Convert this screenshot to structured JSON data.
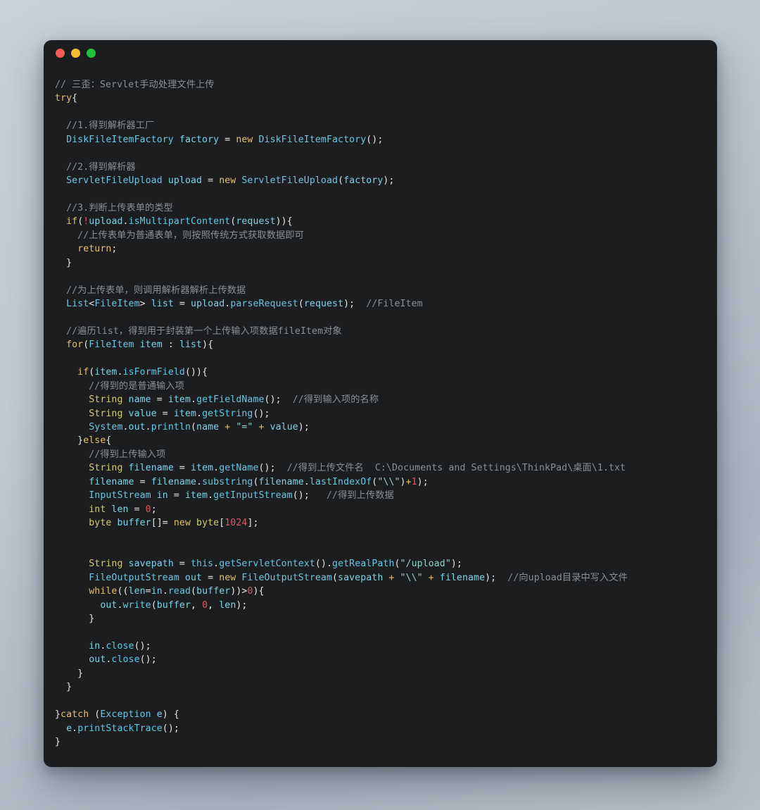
{
  "window": {
    "title": "",
    "traffic_lights": [
      {
        "name": "close",
        "color": "#f25d55"
      },
      {
        "name": "minimize",
        "color": "#f4bd2f"
      },
      {
        "name": "maximize",
        "color": "#21c23c"
      }
    ]
  },
  "editor": {
    "language": "java",
    "theme": "dark",
    "background": "#1b1d1f",
    "page_background": "#c0c8d2",
    "palette": {
      "comment": "#8b9095",
      "keyword": "#e3c06a",
      "type": "#d4cb74",
      "class": "#6fc5e0",
      "identifier": "#7fd3e8",
      "operator": "#e6e6e6",
      "number": "#e05561",
      "string": "#8fd6c4",
      "foreground": "#d7dadd"
    },
    "lines": [
      {
        "n": 1,
        "indent": 0,
        "tokens": [
          {
            "t": "// 三歪：Servlet手动处理文件上传",
            "c": "cm"
          }
        ]
      },
      {
        "n": 2,
        "indent": 0,
        "tokens": [
          {
            "t": "try",
            "c": "kw"
          },
          {
            "t": "{",
            "c": "op"
          }
        ]
      },
      {
        "n": 3,
        "indent": 0,
        "tokens": []
      },
      {
        "n": 4,
        "indent": 1,
        "tokens": [
          {
            "t": "//1.得到解析器工厂",
            "c": "cm"
          }
        ]
      },
      {
        "n": 5,
        "indent": 1,
        "tokens": [
          {
            "t": "DiskFileItemFactory",
            "c": "cls"
          },
          {
            "t": " factory ",
            "c": "id"
          },
          {
            "t": "= ",
            "c": "op"
          },
          {
            "t": "new ",
            "c": "kw"
          },
          {
            "t": "DiskFileItemFactory",
            "c": "cls"
          },
          {
            "t": "();",
            "c": "op"
          }
        ]
      },
      {
        "n": 6,
        "indent": 0,
        "tokens": []
      },
      {
        "n": 7,
        "indent": 1,
        "tokens": [
          {
            "t": "//2.得到解析器",
            "c": "cm"
          }
        ]
      },
      {
        "n": 8,
        "indent": 1,
        "tokens": [
          {
            "t": "ServletFileUpload",
            "c": "cls"
          },
          {
            "t": " upload ",
            "c": "id"
          },
          {
            "t": "= ",
            "c": "op"
          },
          {
            "t": "new ",
            "c": "kw"
          },
          {
            "t": "ServletFileUpload",
            "c": "cls"
          },
          {
            "t": "(",
            "c": "op"
          },
          {
            "t": "factory",
            "c": "id"
          },
          {
            "t": ");",
            "c": "op"
          }
        ]
      },
      {
        "n": 9,
        "indent": 0,
        "tokens": []
      },
      {
        "n": 10,
        "indent": 1,
        "tokens": [
          {
            "t": "//3.判断上传表单的类型",
            "c": "cm"
          }
        ]
      },
      {
        "n": 11,
        "indent": 1,
        "tokens": [
          {
            "t": "if",
            "c": "kw"
          },
          {
            "t": "(",
            "c": "op"
          },
          {
            "t": "!",
            "c": "num"
          },
          {
            "t": "upload",
            "c": "id"
          },
          {
            "t": ".",
            "c": "op"
          },
          {
            "t": "isMultipartContent",
            "c": "fn"
          },
          {
            "t": "(",
            "c": "op"
          },
          {
            "t": "request",
            "c": "id"
          },
          {
            "t": ")){",
            "c": "op"
          }
        ]
      },
      {
        "n": 12,
        "indent": 2,
        "tokens": [
          {
            "t": "//上传表单为普通表单，则按照传统方式获取数据即可",
            "c": "cm"
          }
        ]
      },
      {
        "n": 13,
        "indent": 2,
        "tokens": [
          {
            "t": "return",
            "c": "kw"
          },
          {
            "t": ";",
            "c": "op"
          }
        ]
      },
      {
        "n": 14,
        "indent": 1,
        "tokens": [
          {
            "t": "}",
            "c": "op"
          }
        ]
      },
      {
        "n": 15,
        "indent": 0,
        "tokens": []
      },
      {
        "n": 16,
        "indent": 1,
        "tokens": [
          {
            "t": "//为上传表单，则调用解析器解析上传数据",
            "c": "cm"
          }
        ]
      },
      {
        "n": 17,
        "indent": 1,
        "tokens": [
          {
            "t": "List",
            "c": "cls"
          },
          {
            "t": "<",
            "c": "op"
          },
          {
            "t": "FileItem",
            "c": "cls"
          },
          {
            "t": "> ",
            "c": "op"
          },
          {
            "t": "list ",
            "c": "id"
          },
          {
            "t": "= ",
            "c": "op"
          },
          {
            "t": "upload",
            "c": "id"
          },
          {
            "t": ".",
            "c": "op"
          },
          {
            "t": "parseRequest",
            "c": "fn"
          },
          {
            "t": "(",
            "c": "op"
          },
          {
            "t": "request",
            "c": "id"
          },
          {
            "t": ");  ",
            "c": "op"
          },
          {
            "t": "//FileItem",
            "c": "cm"
          }
        ]
      },
      {
        "n": 18,
        "indent": 0,
        "tokens": []
      },
      {
        "n": 19,
        "indent": 1,
        "tokens": [
          {
            "t": "//遍历list，得到用于封装第一个上传输入项数据fileItem对象",
            "c": "cm"
          }
        ]
      },
      {
        "n": 20,
        "indent": 1,
        "tokens": [
          {
            "t": "for",
            "c": "kw"
          },
          {
            "t": "(",
            "c": "op"
          },
          {
            "t": "FileItem",
            "c": "cls"
          },
          {
            "t": " item ",
            "c": "id"
          },
          {
            "t": ": ",
            "c": "op"
          },
          {
            "t": "list",
            "c": "id"
          },
          {
            "t": "){",
            "c": "op"
          }
        ]
      },
      {
        "n": 21,
        "indent": 0,
        "tokens": []
      },
      {
        "n": 22,
        "indent": 2,
        "tokens": [
          {
            "t": "if",
            "c": "kw"
          },
          {
            "t": "(",
            "c": "op"
          },
          {
            "t": "item",
            "c": "id"
          },
          {
            "t": ".",
            "c": "op"
          },
          {
            "t": "isFormField",
            "c": "fn"
          },
          {
            "t": "()){",
            "c": "op"
          }
        ]
      },
      {
        "n": 23,
        "indent": 3,
        "tokens": [
          {
            "t": "//得到的是普通输入项",
            "c": "cm"
          }
        ]
      },
      {
        "n": 24,
        "indent": 3,
        "tokens": [
          {
            "t": "String",
            "c": "ty"
          },
          {
            "t": " name ",
            "c": "id"
          },
          {
            "t": "= ",
            "c": "op"
          },
          {
            "t": "item",
            "c": "id"
          },
          {
            "t": ".",
            "c": "op"
          },
          {
            "t": "getFieldName",
            "c": "fn"
          },
          {
            "t": "();  ",
            "c": "op"
          },
          {
            "t": "//得到输入项的名称",
            "c": "cm"
          }
        ]
      },
      {
        "n": 25,
        "indent": 3,
        "tokens": [
          {
            "t": "String",
            "c": "ty"
          },
          {
            "t": " value ",
            "c": "id"
          },
          {
            "t": "= ",
            "c": "op"
          },
          {
            "t": "item",
            "c": "id"
          },
          {
            "t": ".",
            "c": "op"
          },
          {
            "t": "getString",
            "c": "fn"
          },
          {
            "t": "();",
            "c": "op"
          }
        ]
      },
      {
        "n": 26,
        "indent": 3,
        "tokens": [
          {
            "t": "System",
            "c": "cls"
          },
          {
            "t": ".",
            "c": "op"
          },
          {
            "t": "out",
            "c": "id"
          },
          {
            "t": ".",
            "c": "op"
          },
          {
            "t": "println",
            "c": "fn"
          },
          {
            "t": "(",
            "c": "op"
          },
          {
            "t": "name ",
            "c": "id"
          },
          {
            "t": "+ ",
            "c": "opy"
          },
          {
            "t": "\"=\"",
            "c": "str"
          },
          {
            "t": " + ",
            "c": "opy"
          },
          {
            "t": "value",
            "c": "id"
          },
          {
            "t": ");",
            "c": "op"
          }
        ]
      },
      {
        "n": 27,
        "indent": 2,
        "tokens": [
          {
            "t": "}",
            "c": "op"
          },
          {
            "t": "else",
            "c": "kw"
          },
          {
            "t": "{",
            "c": "op"
          }
        ]
      },
      {
        "n": 28,
        "indent": 3,
        "tokens": [
          {
            "t": "//得到上传输入项",
            "c": "cm"
          }
        ]
      },
      {
        "n": 29,
        "indent": 3,
        "tokens": [
          {
            "t": "String",
            "c": "ty"
          },
          {
            "t": " filename ",
            "c": "id"
          },
          {
            "t": "= ",
            "c": "op"
          },
          {
            "t": "item",
            "c": "id"
          },
          {
            "t": ".",
            "c": "op"
          },
          {
            "t": "getName",
            "c": "fn"
          },
          {
            "t": "();  ",
            "c": "op"
          },
          {
            "t": "//得到上传文件名  C:\\Documents and Settings\\ThinkPad\\桌面\\1.txt",
            "c": "cm"
          }
        ]
      },
      {
        "n": 30,
        "indent": 3,
        "tokens": [
          {
            "t": "filename ",
            "c": "id"
          },
          {
            "t": "= ",
            "c": "op"
          },
          {
            "t": "filename",
            "c": "id"
          },
          {
            "t": ".",
            "c": "op"
          },
          {
            "t": "substring",
            "c": "fn"
          },
          {
            "t": "(",
            "c": "op"
          },
          {
            "t": "filename",
            "c": "id"
          },
          {
            "t": ".",
            "c": "op"
          },
          {
            "t": "lastIndexOf",
            "c": "fn"
          },
          {
            "t": "(",
            "c": "op"
          },
          {
            "t": "\"\\\\\"",
            "c": "str"
          },
          {
            "t": ")",
            "c": "op"
          },
          {
            "t": "+",
            "c": "opy"
          },
          {
            "t": "1",
            "c": "num"
          },
          {
            "t": ");",
            "c": "op"
          }
        ]
      },
      {
        "n": 31,
        "indent": 3,
        "tokens": [
          {
            "t": "InputStream",
            "c": "cls"
          },
          {
            "t": " in ",
            "c": "id"
          },
          {
            "t": "= ",
            "c": "op"
          },
          {
            "t": "item",
            "c": "id"
          },
          {
            "t": ".",
            "c": "op"
          },
          {
            "t": "getInputStream",
            "c": "fn"
          },
          {
            "t": "();   ",
            "c": "op"
          },
          {
            "t": "//得到上传数据",
            "c": "cm"
          }
        ]
      },
      {
        "n": 32,
        "indent": 3,
        "tokens": [
          {
            "t": "int",
            "c": "ty"
          },
          {
            "t": " len ",
            "c": "id"
          },
          {
            "t": "= ",
            "c": "op"
          },
          {
            "t": "0",
            "c": "num"
          },
          {
            "t": ";",
            "c": "op"
          }
        ]
      },
      {
        "n": 33,
        "indent": 3,
        "tokens": [
          {
            "t": "byte",
            "c": "ty"
          },
          {
            "t": " buffer",
            "c": "id"
          },
          {
            "t": "[]= ",
            "c": "op"
          },
          {
            "t": "new ",
            "c": "kw"
          },
          {
            "t": "byte",
            "c": "ty"
          },
          {
            "t": "[",
            "c": "op"
          },
          {
            "t": "1024",
            "c": "num"
          },
          {
            "t": "];",
            "c": "op"
          }
        ]
      },
      {
        "n": 34,
        "indent": 0,
        "tokens": []
      },
      {
        "n": 35,
        "indent": 0,
        "tokens": []
      },
      {
        "n": 36,
        "indent": 3,
        "tokens": [
          {
            "t": "String",
            "c": "ty"
          },
          {
            "t": " savepath ",
            "c": "id"
          },
          {
            "t": "= ",
            "c": "op"
          },
          {
            "t": "this",
            "c": "cls"
          },
          {
            "t": ".",
            "c": "op"
          },
          {
            "t": "getServletContext",
            "c": "fn"
          },
          {
            "t": "()",
            "c": "op"
          },
          {
            "t": ".",
            "c": "op"
          },
          {
            "t": "getRealPath",
            "c": "fn"
          },
          {
            "t": "(",
            "c": "op"
          },
          {
            "t": "\"/upload\"",
            "c": "str"
          },
          {
            "t": ");",
            "c": "op"
          }
        ]
      },
      {
        "n": 37,
        "indent": 3,
        "tokens": [
          {
            "t": "FileOutputStream",
            "c": "cls"
          },
          {
            "t": " out ",
            "c": "id"
          },
          {
            "t": "= ",
            "c": "op"
          },
          {
            "t": "new ",
            "c": "kw"
          },
          {
            "t": "FileOutputStream",
            "c": "cls"
          },
          {
            "t": "(",
            "c": "op"
          },
          {
            "t": "savepath ",
            "c": "id"
          },
          {
            "t": "+ ",
            "c": "opy"
          },
          {
            "t": "\"\\\\\"",
            "c": "str"
          },
          {
            "t": " + ",
            "c": "opy"
          },
          {
            "t": "filename",
            "c": "id"
          },
          {
            "t": ");  ",
            "c": "op"
          },
          {
            "t": "//向upload目录中写入文件",
            "c": "cm"
          }
        ]
      },
      {
        "n": 38,
        "indent": 3,
        "tokens": [
          {
            "t": "while",
            "c": "kw"
          },
          {
            "t": "((",
            "c": "op"
          },
          {
            "t": "len",
            "c": "id"
          },
          {
            "t": "=",
            "c": "op"
          },
          {
            "t": "in",
            "c": "id"
          },
          {
            "t": ".",
            "c": "op"
          },
          {
            "t": "read",
            "c": "fn"
          },
          {
            "t": "(",
            "c": "op"
          },
          {
            "t": "buffer",
            "c": "id"
          },
          {
            "t": "))>",
            "c": "op"
          },
          {
            "t": "0",
            "c": "num"
          },
          {
            "t": "){",
            "c": "op"
          }
        ]
      },
      {
        "n": 39,
        "indent": 4,
        "tokens": [
          {
            "t": "out",
            "c": "id"
          },
          {
            "t": ".",
            "c": "op"
          },
          {
            "t": "write",
            "c": "fn"
          },
          {
            "t": "(",
            "c": "op"
          },
          {
            "t": "buffer",
            "c": "id"
          },
          {
            "t": ", ",
            "c": "op"
          },
          {
            "t": "0",
            "c": "num"
          },
          {
            "t": ", ",
            "c": "op"
          },
          {
            "t": "len",
            "c": "id"
          },
          {
            "t": ");",
            "c": "op"
          }
        ]
      },
      {
        "n": 40,
        "indent": 3,
        "tokens": [
          {
            "t": "}",
            "c": "op"
          }
        ]
      },
      {
        "n": 41,
        "indent": 0,
        "tokens": []
      },
      {
        "n": 42,
        "indent": 3,
        "tokens": [
          {
            "t": "in",
            "c": "id"
          },
          {
            "t": ".",
            "c": "op"
          },
          {
            "t": "close",
            "c": "fn"
          },
          {
            "t": "();",
            "c": "op"
          }
        ]
      },
      {
        "n": 43,
        "indent": 3,
        "tokens": [
          {
            "t": "out",
            "c": "id"
          },
          {
            "t": ".",
            "c": "op"
          },
          {
            "t": "close",
            "c": "fn"
          },
          {
            "t": "();",
            "c": "op"
          }
        ]
      },
      {
        "n": 44,
        "indent": 2,
        "tokens": [
          {
            "t": "}",
            "c": "op"
          }
        ]
      },
      {
        "n": 45,
        "indent": 1,
        "tokens": [
          {
            "t": "}",
            "c": "op"
          }
        ]
      },
      {
        "n": 46,
        "indent": 0,
        "tokens": []
      },
      {
        "n": 47,
        "indent": 0,
        "tokens": [
          {
            "t": "}",
            "c": "op"
          },
          {
            "t": "catch",
            "c": "kw"
          },
          {
            "t": " (",
            "c": "op"
          },
          {
            "t": "Exception",
            "c": "cls"
          },
          {
            "t": " e",
            "c": "id"
          },
          {
            "t": ") {",
            "c": "op"
          }
        ]
      },
      {
        "n": 48,
        "indent": 1,
        "tokens": [
          {
            "t": "e",
            "c": "id"
          },
          {
            "t": ".",
            "c": "op"
          },
          {
            "t": "printStackTrace",
            "c": "fn"
          },
          {
            "t": "();",
            "c": "op"
          }
        ]
      },
      {
        "n": 49,
        "indent": 0,
        "tokens": [
          {
            "t": "}",
            "c": "op"
          }
        ]
      }
    ]
  }
}
